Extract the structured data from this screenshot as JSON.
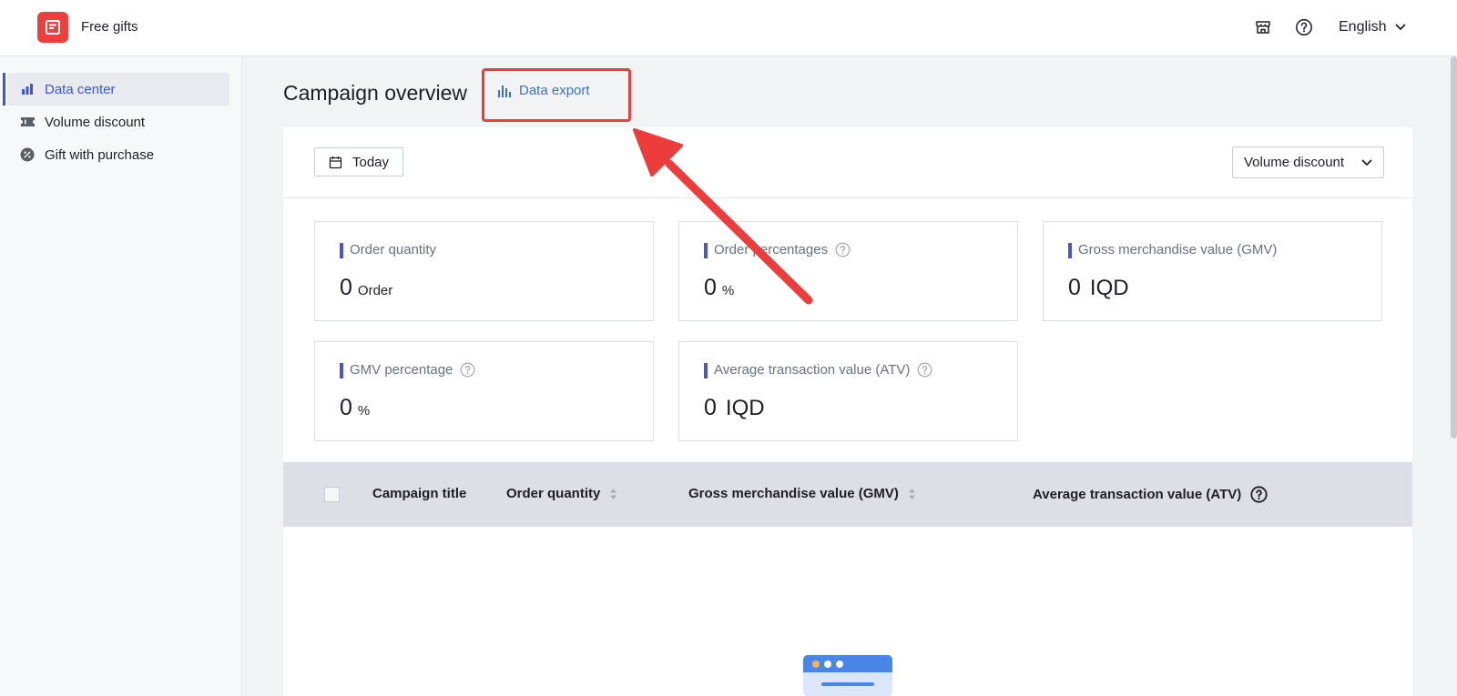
{
  "header": {
    "app_name": "Free gifts",
    "language": "English",
    "icons": [
      "store-icon",
      "help-icon",
      "chevron-down-icon"
    ]
  },
  "sidebar": {
    "items": [
      {
        "label": "Data center",
        "icon": "bar-chart-icon",
        "active": true
      },
      {
        "label": "Volume discount",
        "icon": "ticket-icon",
        "active": false
      },
      {
        "label": "Gift with purchase",
        "icon": "percent-badge-icon",
        "active": false
      }
    ]
  },
  "page": {
    "title": "Campaign overview",
    "export_label": "Data export"
  },
  "filters": {
    "date_label": "Today",
    "campaign_type": "Volume discount"
  },
  "metrics": [
    {
      "label": "Order quantity",
      "value": "0",
      "unit": "Order",
      "help": false
    },
    {
      "label": "Order percentages",
      "value": "0",
      "unit": "%",
      "help": true
    },
    {
      "label": "Gross merchandise value (GMV)",
      "value": "0",
      "unit": "IQD",
      "help": false
    },
    {
      "label": "GMV percentage",
      "value": "0",
      "unit": "%",
      "help": true
    },
    {
      "label": "Average transaction value (ATV)",
      "value": "0",
      "unit": "IQD",
      "help": true
    }
  ],
  "table": {
    "columns": [
      {
        "label": "Campaign title",
        "sortable": false
      },
      {
        "label": "Order quantity",
        "sortable": true
      },
      {
        "label": "Gross merchandise value (GMV)",
        "sortable": true
      },
      {
        "label": "Average transaction value (ATV)",
        "sortable": false,
        "help": true
      }
    ],
    "rows": []
  },
  "colors": {
    "accent": "#3b57d9",
    "link": "#3b6fd9",
    "brand_red": "#ee3f3f",
    "metric_bar": "#4a53d4",
    "annotation": "#ee3b3b"
  }
}
